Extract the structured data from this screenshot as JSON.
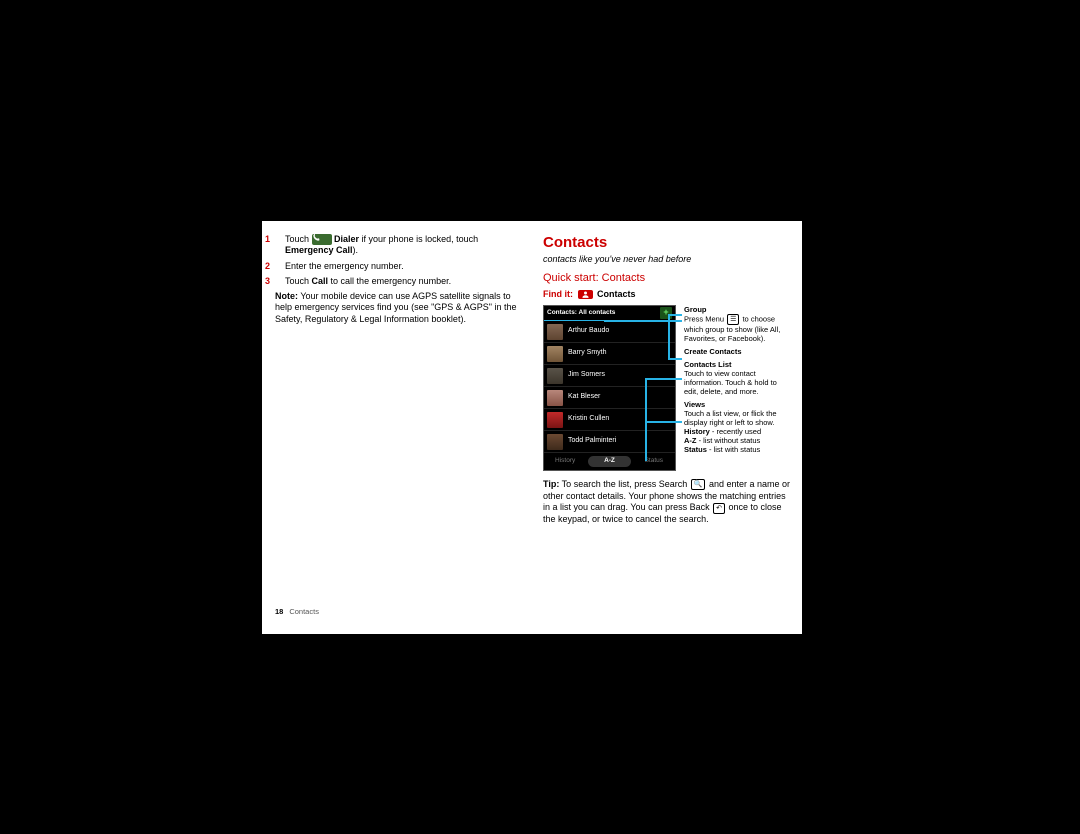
{
  "left": {
    "step1_a": "Touch ",
    "step1_b": " Dialer",
    "step1_c": " if your phone is locked, touch ",
    "step1_d": "Emergency Call",
    "step1_e": ").",
    "step2": "Enter the emergency number.",
    "step3_a": "Touch ",
    "step3_b": "Call",
    "step3_c": " to call the emergency number.",
    "note_lead": "Note:",
    "note_body": " Your mobile device can use AGPS satellite signals to help emergency services find you (see \"GPS & AGPS\" in the Safety, Regulatory & Legal Information booklet)."
  },
  "right": {
    "title": "Contacts",
    "subtitle": "contacts like you've never had before",
    "qstart": "Quick start: Contacts",
    "findit_label": "Find it:",
    "findit_text": "Contacts",
    "phone": {
      "header": "Contacts: All contacts",
      "plus": "+",
      "rows": [
        "Arthur Baudo",
        "Barry Smyth",
        "Jim Somers",
        "Kat Bleser",
        "Kristin Cullen",
        "Todd Palminteri"
      ],
      "tabs": {
        "history": "History",
        "az": "A-Z",
        "status": "Status"
      }
    },
    "anno": {
      "group_h": "Group",
      "group_t": "Press Menu ",
      "group_t2": " to choose which group to show (like All, Favorites, or Facebook).",
      "create_h": "Create Contacts",
      "list_h": "Contacts  List",
      "list_t": "Touch to view contact information. Touch & hold to edit, delete, and more.",
      "views_h": "Views",
      "views_t": "Touch a list view, or flick the display right or left to show.",
      "history_b": "History",
      "history_t": " - recently used",
      "az_b": "A-Z",
      "az_t": " - list without status",
      "status_b": "Status",
      "status_t": " - list with status"
    },
    "tip_lead": "Tip:",
    "tip_a": " To search the list, press Search ",
    "tip_b": " and enter a name or other contact details. Your phone shows the matching entries in a list you can drag. You can press Back ",
    "tip_c": " once to close the keypad, or twice to cancel the search."
  },
  "footer": {
    "page": "18",
    "section": "Contacts"
  },
  "icons": {
    "phone_glyph": "📞",
    "menu_glyph": "☰",
    "search_glyph": "🔍",
    "back_glyph": "↶"
  }
}
